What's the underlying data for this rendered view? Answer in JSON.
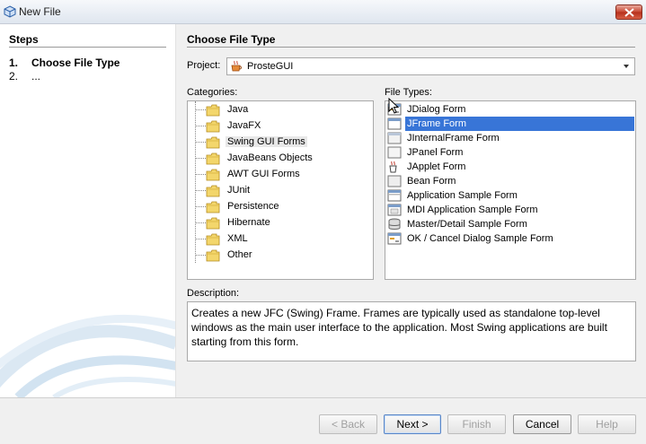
{
  "window": {
    "title": "New File"
  },
  "steps": {
    "heading": "Steps",
    "items": [
      {
        "num": "1.",
        "label": "Choose File Type"
      },
      {
        "num": "2.",
        "label": "..."
      }
    ]
  },
  "main": {
    "heading": "Choose File Type",
    "project_label": "Project:",
    "project_value": "ProsteGUI",
    "categories_label": "Categories:",
    "file_types_label": "File Types:",
    "categories": [
      "Java",
      "JavaFX",
      "Swing GUI Forms",
      "JavaBeans Objects",
      "AWT GUI Forms",
      "JUnit",
      "Persistence",
      "Hibernate",
      "XML",
      "Other"
    ],
    "selected_category": "Swing GUI Forms",
    "file_types": [
      {
        "label": "JDialog Form",
        "icon": "dialog-form-icon"
      },
      {
        "label": "JFrame Form",
        "icon": "frame-form-icon"
      },
      {
        "label": "JInternalFrame Form",
        "icon": "internal-frame-icon"
      },
      {
        "label": "JPanel Form",
        "icon": "panel-form-icon"
      },
      {
        "label": "JApplet Form",
        "icon": "applet-form-icon"
      },
      {
        "label": "Bean Form",
        "icon": "bean-form-icon"
      },
      {
        "label": "Application Sample Form",
        "icon": "application-form-icon"
      },
      {
        "label": "MDI Application Sample Form",
        "icon": "mdi-form-icon"
      },
      {
        "label": "Master/Detail Sample Form",
        "icon": "database-form-icon"
      },
      {
        "label": "OK / Cancel Dialog Sample Form",
        "icon": "dialog-form-icon"
      }
    ],
    "selected_file_type": "JFrame Form",
    "description_label": "Description:",
    "description": "Creates a new JFC (Swing) Frame. Frames are typically used as standalone top-level windows as the main user interface to the application. Most Swing applications are built starting from this form."
  },
  "buttons": {
    "back": "< Back",
    "next": "Next >",
    "finish": "Finish",
    "cancel": "Cancel",
    "help": "Help"
  },
  "colors": {
    "selection": "#3875d7",
    "close_button": "#c7442f"
  }
}
